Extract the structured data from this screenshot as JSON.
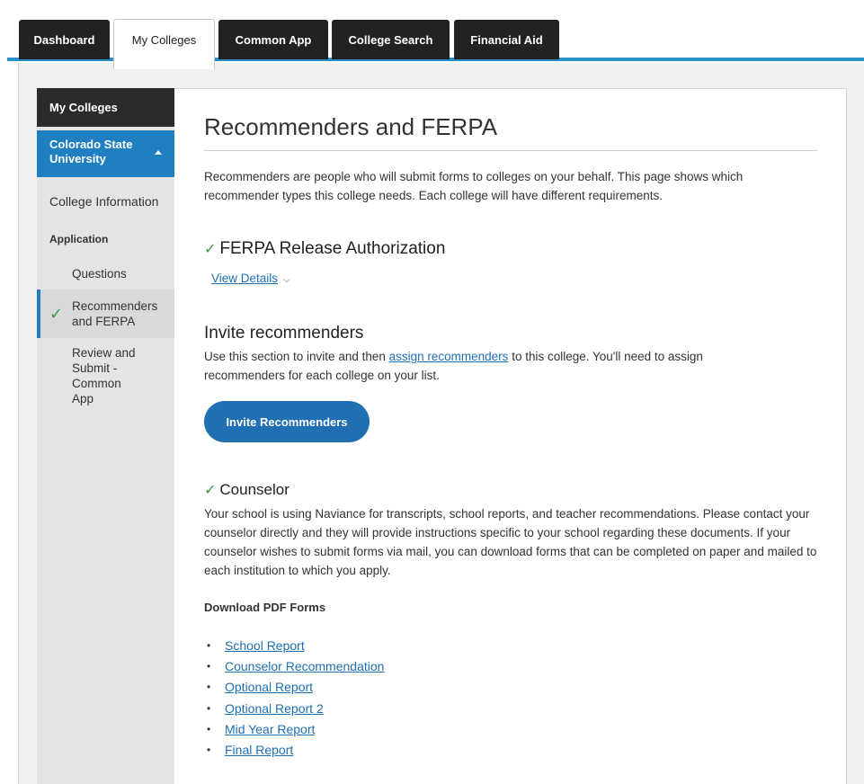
{
  "tabs": [
    {
      "label": "Dashboard"
    },
    {
      "label": "My Colleges"
    },
    {
      "label": "Common App"
    },
    {
      "label": "College Search"
    },
    {
      "label": "Financial Aid"
    }
  ],
  "sidebar": {
    "title": "My Colleges",
    "college": "Colorado State University",
    "college_info": "College Information",
    "section": "Application",
    "items": [
      {
        "label": "Questions"
      },
      {
        "label": "Recommenders and FERPA"
      },
      {
        "label": "Review and Submit - Common App"
      }
    ]
  },
  "main": {
    "title": "Recommenders and FERPA",
    "intro": "Recommenders are people who will submit forms to colleges on your behalf. This page shows which recommender types this college needs. Each college will have different requirements.",
    "ferpa_heading": "FERPA Release Authorization",
    "view_details": "View Details",
    "invite_heading": "Invite recommenders",
    "invite_text_before": "Use this section to invite and then ",
    "invite_link": "assign recommenders",
    "invite_text_after": " to this college. You'll need to assign recommenders for each college on your list.",
    "invite_button": "Invite Recommenders",
    "counselor_heading": "Counselor",
    "counselor_text": "Your school is using Naviance for transcripts, school reports, and teacher recommendations. Please contact your counselor directly and they will provide instructions specific to your school regarding these documents. If your counselor wishes to submit forms via mail, you can download forms that can be completed on paper and mailed to each institution to which you apply.",
    "download_heading": "Download PDF Forms",
    "forms": [
      {
        "label": "School Report"
      },
      {
        "label": "Counselor Recommendation"
      },
      {
        "label": "Optional Report"
      },
      {
        "label": "Optional Report 2"
      },
      {
        "label": "Mid Year Report"
      },
      {
        "label": "Final Report"
      }
    ]
  },
  "colors": {
    "accent": "#1f6fb2",
    "nav_dark": "#222222",
    "college_blue": "#1f7fc0",
    "check_green": "#3b9a44"
  }
}
